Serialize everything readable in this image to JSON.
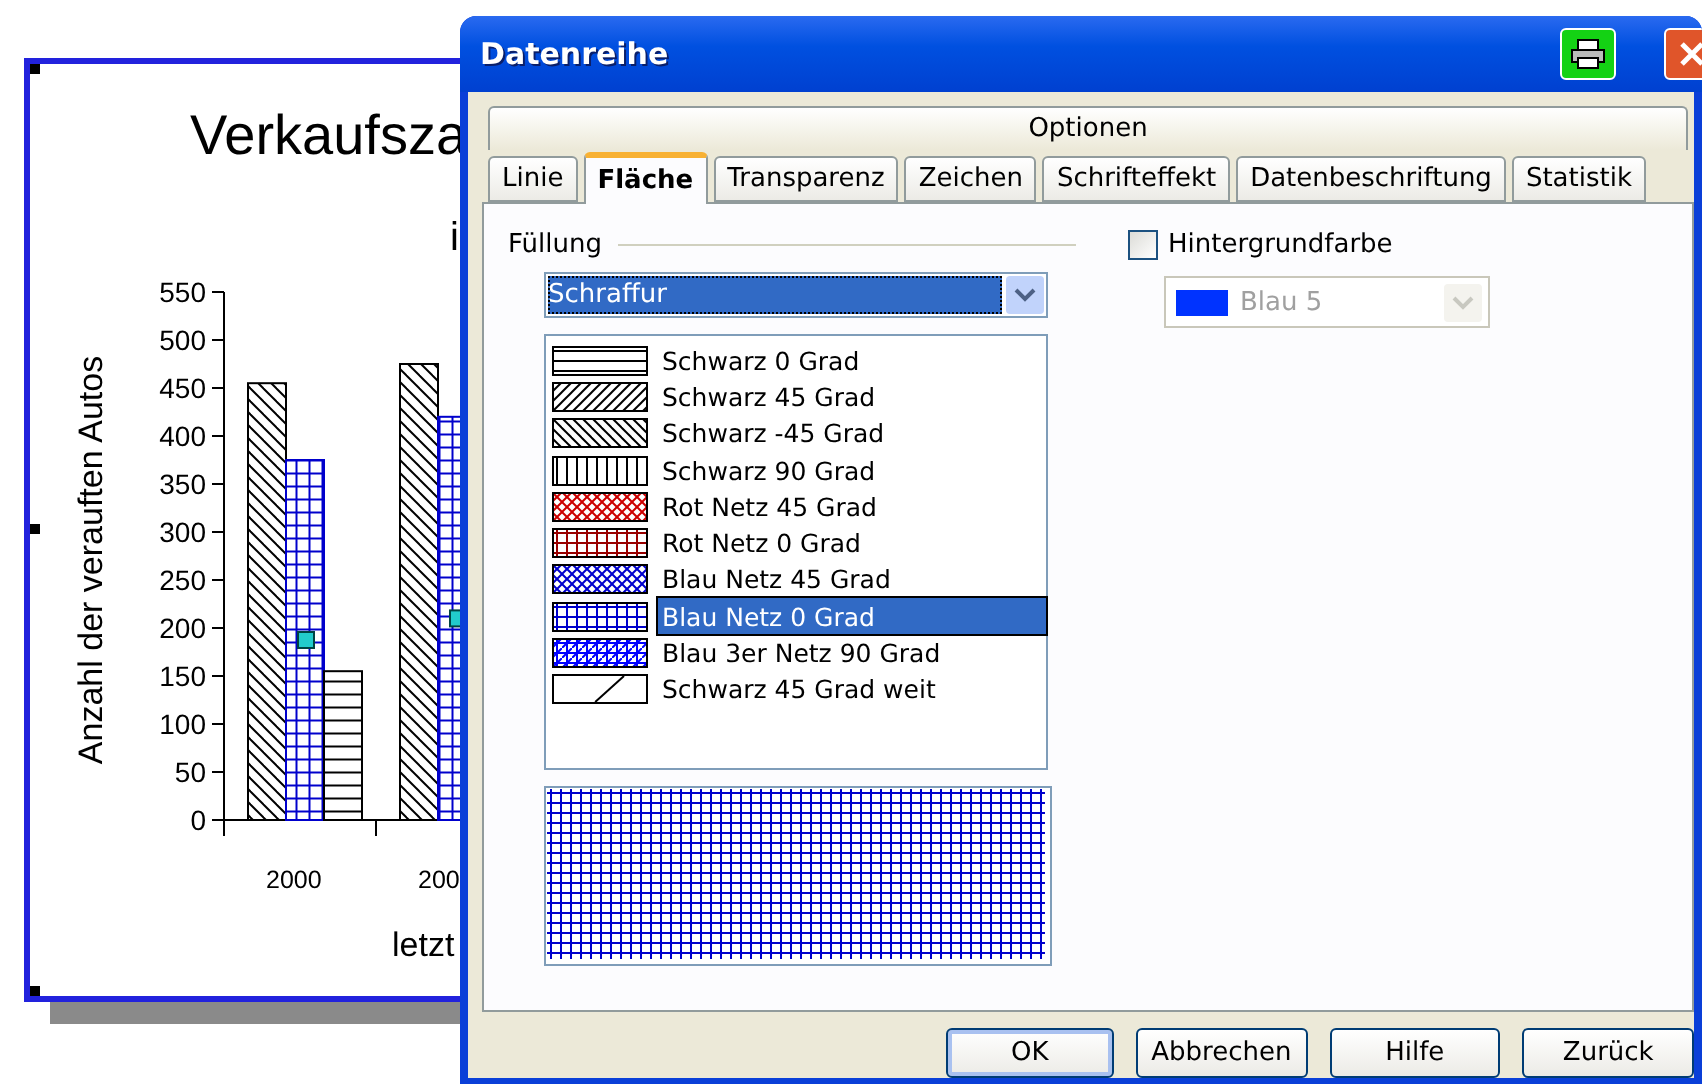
{
  "chart": {
    "subtitle": "i",
    "chart_data": {
      "type": "bar",
      "title": "Verkaufsza",
      "xlabel": "letzt",
      "ylabel": "Anzahl der verauften Autos",
      "categories": [
        "2000",
        "200"
      ],
      "ylim": [
        0,
        550
      ],
      "yticks": [
        0,
        50,
        100,
        150,
        200,
        250,
        300,
        350,
        400,
        450,
        500,
        550
      ],
      "series": [
        {
          "color": "#000000",
          "values": [
            455,
            475
          ]
        },
        {
          "color": "#0000cc",
          "values": [
            375,
            420
          ]
        },
        {
          "color": "#000000",
          "values": [
            155,
            null
          ]
        }
      ]
    }
  },
  "dialog": {
    "title": "Datenreihe",
    "tab_group": "Optionen",
    "tabs": [
      {
        "label": "Linie",
        "selected": false
      },
      {
        "label": "Fläche",
        "selected": true
      },
      {
        "label": "Transparenz",
        "selected": false
      },
      {
        "label": "Zeichen",
        "selected": false
      },
      {
        "label": "Schrifteffekt",
        "selected": false
      },
      {
        "label": "Datenbeschriftung",
        "selected": false
      },
      {
        "label": "Statistik",
        "selected": false
      }
    ],
    "fill": {
      "label": "Füllung",
      "type": "Schraffur",
      "hatches": [
        {
          "label": "Schwarz 0 Grad",
          "kind": "horizontal",
          "color": "#000000",
          "selected": false
        },
        {
          "label": "Schwarz 45 Grad",
          "kind": "diagonal",
          "color": "#000000",
          "selected": false
        },
        {
          "label": "Schwarz -45 Grad",
          "kind": "backdiagonal",
          "color": "#000000",
          "selected": false
        },
        {
          "label": "Schwarz 90 Grad",
          "kind": "vertical",
          "color": "#000000",
          "selected": false
        },
        {
          "label": "Rot Netz 45 Grad",
          "kind": "diagcross",
          "color": "#cc0000",
          "selected": false
        },
        {
          "label": "Rot Netz 0 Grad",
          "kind": "cross",
          "color": "#990000",
          "selected": false
        },
        {
          "label": "Blau Netz 45 Grad",
          "kind": "diagcross",
          "color": "#0000cc",
          "selected": false
        },
        {
          "label": "Blau Netz 0 Grad",
          "kind": "cross",
          "color": "#0000cc",
          "selected": true
        },
        {
          "label": "Blau 3er Netz 90 Grad",
          "kind": "triple",
          "color": "#0000ff",
          "selected": false
        },
        {
          "label": "Schwarz 45 Grad weit",
          "kind": "wide",
          "color": "#000000",
          "selected": false
        }
      ]
    },
    "background": {
      "label": "Hintergrundfarbe",
      "checked": false,
      "color_field": {
        "value": "Blau 5",
        "color": "#0033ff",
        "disabled": true
      }
    },
    "buttons": [
      {
        "label": "OK",
        "default": true
      },
      {
        "label": "Abbrechen",
        "default": false
      },
      {
        "label": "Hilfe",
        "default": false
      },
      {
        "label": "Zurück",
        "default": false
      }
    ]
  }
}
